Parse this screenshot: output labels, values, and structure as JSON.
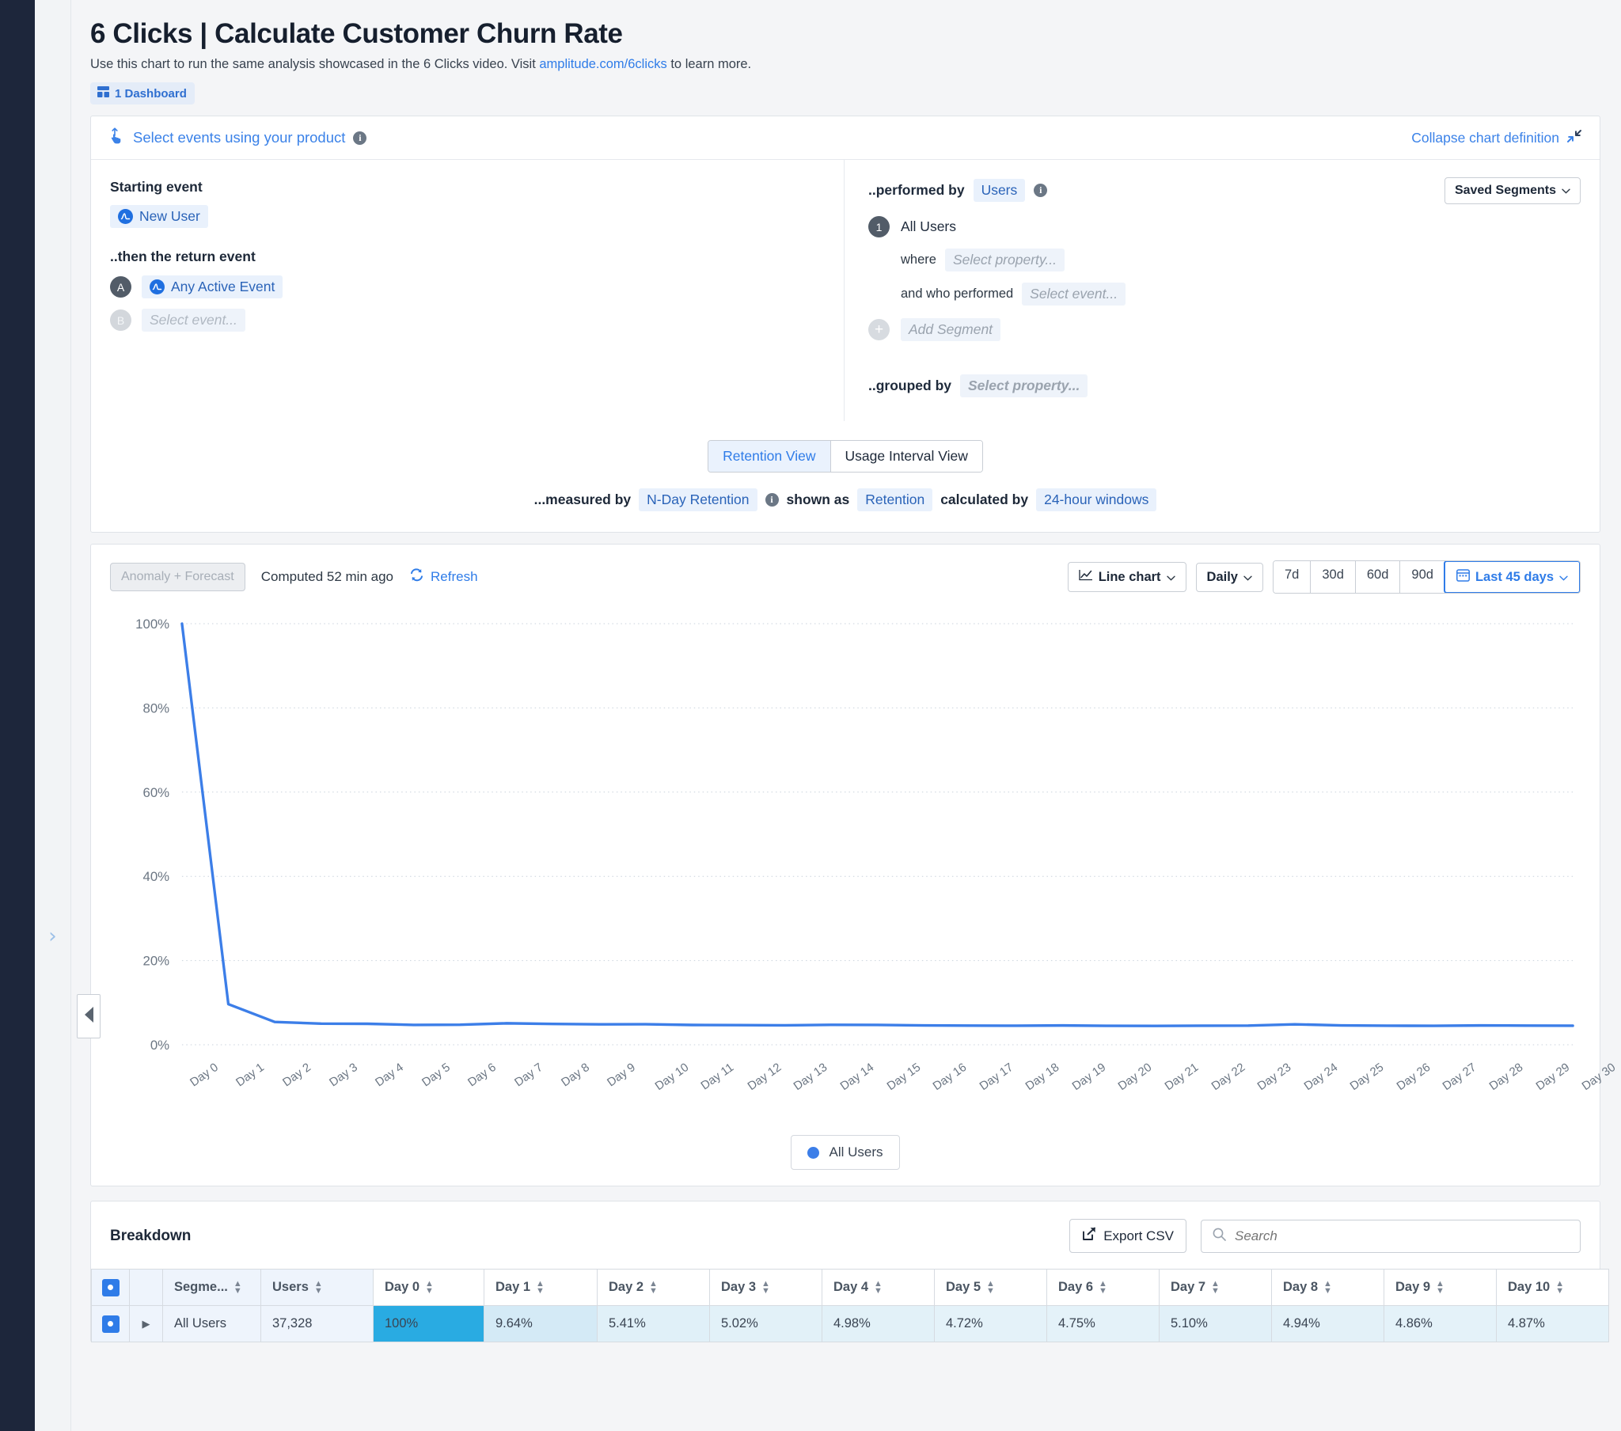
{
  "header": {
    "title": "6 Clicks | Calculate Customer Churn Rate",
    "subtitle_before": "Use this chart to run the same analysis showcased in the 6 Clicks video. Visit ",
    "subtitle_link": "amplitude.com/6clicks",
    "subtitle_after": " to learn more.",
    "dashboard_badge": "1 Dashboard"
  },
  "definition": {
    "select_events_label": "Select events using your product",
    "collapse_label": "Collapse chart definition",
    "starting_event_label": "Starting event",
    "starting_event": "New User",
    "then_return_label": "..then the return event",
    "return_events": [
      {
        "badge": "A",
        "label": "Any Active Event",
        "placeholder": false
      },
      {
        "badge": "B",
        "label": "Select event...",
        "placeholder": true
      }
    ],
    "performed_by_label": "..performed by",
    "performed_by_value": "Users",
    "saved_segments_label": "Saved Segments",
    "segment_number": "1",
    "segment_name": "All Users",
    "where_label": "where",
    "where_value": "Select property...",
    "and_who_performed_label": "and who performed",
    "and_who_performed_value": "Select event...",
    "add_segment_label": "Add Segment",
    "grouped_by_label": "..grouped by",
    "grouped_by_value": "Select property...",
    "views": [
      {
        "label": "Retention View",
        "active": true
      },
      {
        "label": "Usage Interval View",
        "active": false
      }
    ],
    "measured_by_label": "...measured by",
    "measured_by_value": "N-Day Retention",
    "shown_as_label": "shown as",
    "shown_as_value": "Retention",
    "calculated_by_label": "calculated by",
    "calculated_by_value": "24-hour windows"
  },
  "chart_toolbar": {
    "anomaly_label": "Anomaly + Forecast",
    "computed_label": "Computed 52 min ago",
    "refresh_label": "Refresh",
    "chart_type": "Line chart",
    "interval": "Daily",
    "ranges": [
      "7d",
      "30d",
      "60d",
      "90d"
    ],
    "active_range": "Last 45 days"
  },
  "chart_data": {
    "type": "line",
    "title": "",
    "xlabel": "",
    "ylabel": "",
    "ylim": [
      0,
      100
    ],
    "ytick_labels": [
      "0%",
      "20%",
      "40%",
      "60%",
      "80%",
      "100%"
    ],
    "yticks": [
      0,
      20,
      40,
      60,
      80,
      100
    ],
    "grid": true,
    "legend_position": "bottom",
    "categories": [
      "Day 0",
      "Day 1",
      "Day 2",
      "Day 3",
      "Day 4",
      "Day 5",
      "Day 6",
      "Day 7",
      "Day 8",
      "Day 9",
      "Day 10",
      "Day 11",
      "Day 12",
      "Day 13",
      "Day 14",
      "Day 15",
      "Day 16",
      "Day 17",
      "Day 18",
      "Day 19",
      "Day 20",
      "Day 21",
      "Day 22",
      "Day 23",
      "Day 24",
      "Day 25",
      "Day 26",
      "Day 27",
      "Day 28",
      "Day 29",
      "Day 30"
    ],
    "series": [
      {
        "name": "All Users",
        "color": "#3c7ee8",
        "values": [
          100,
          9.64,
          5.41,
          5.02,
          4.98,
          4.72,
          4.75,
          5.1,
          4.94,
          4.86,
          4.87,
          4.7,
          4.66,
          4.62,
          4.74,
          4.72,
          4.6,
          4.55,
          4.52,
          4.58,
          4.5,
          4.48,
          4.52,
          4.55,
          4.86,
          4.6,
          4.52,
          4.5,
          4.58,
          4.55,
          4.52
        ]
      }
    ],
    "legend": [
      "All Users"
    ]
  },
  "breakdown": {
    "title": "Breakdown",
    "export_label": "Export CSV",
    "search_placeholder": "Search",
    "columns": [
      "Segme...",
      "Users",
      "Day 0",
      "Day 1",
      "Day 2",
      "Day 3",
      "Day 4",
      "Day 5",
      "Day 6",
      "Day 7",
      "Day 8",
      "Day 9",
      "Day 10"
    ],
    "rows": [
      {
        "segment": "All Users",
        "users": "37,328",
        "values": [
          "100%",
          "9.64%",
          "5.41%",
          "5.02%",
          "4.98%",
          "4.72%",
          "4.75%",
          "5.10%",
          "4.94%",
          "4.86%",
          "4.87%"
        ]
      }
    ]
  },
  "colors": {
    "accent": "#2f7ce8",
    "series": "#3c7ee8",
    "day0_cell": "#29abe2",
    "rail": "#1d263b"
  }
}
